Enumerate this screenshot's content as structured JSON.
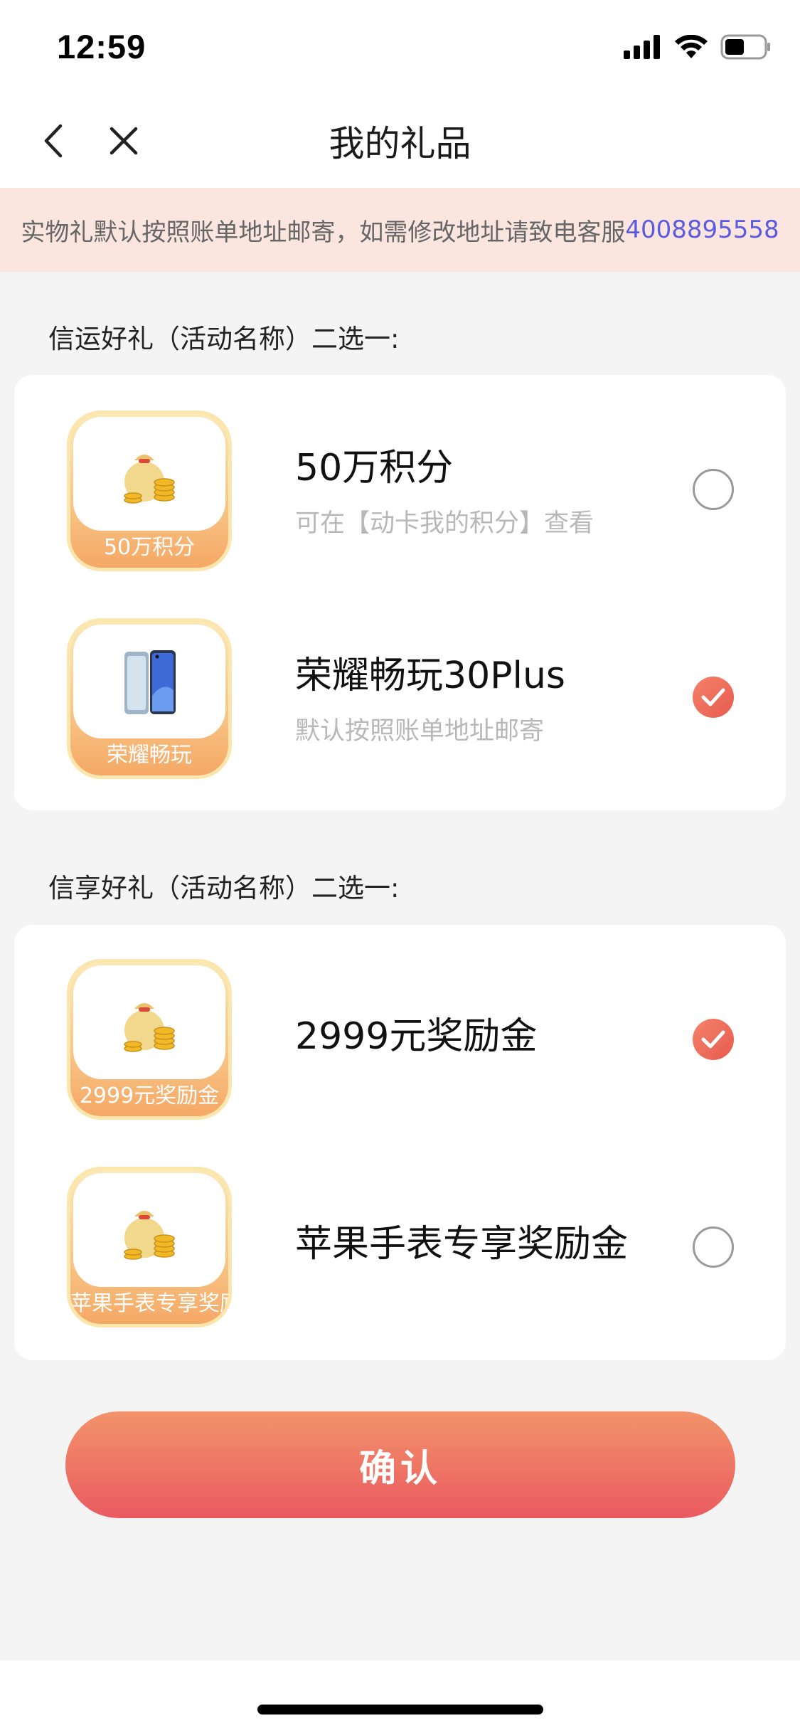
{
  "status_bar": {
    "time": "12:59"
  },
  "nav": {
    "title": "我的礼品"
  },
  "notice": {
    "text": "实物礼默认按照账单地址邮寄，如需修改地址请致电客服",
    "phone": "4008895558"
  },
  "sections": [
    {
      "title": "信运好礼（活动名称）二选一:",
      "items": [
        {
          "thumb_label": "50万积分",
          "title": "50万积分",
          "subtitle": "可在【动卡我的积分】查看",
          "checked": false,
          "icon": "money-bag-icon"
        },
        {
          "thumb_label": "荣耀畅玩",
          "title": "荣耀畅玩30Plus",
          "subtitle": "默认按照账单地址邮寄",
          "checked": true,
          "icon": "phone-icon"
        }
      ]
    },
    {
      "title": "信享好礼（活动名称）二选一:",
      "items": [
        {
          "thumb_label": "2999元奖励金",
          "title": "2999元奖励金",
          "subtitle": "",
          "checked": true,
          "icon": "money-bag-icon"
        },
        {
          "thumb_label": "苹果手表专享奖励金",
          "title": "苹果手表专享奖励金",
          "subtitle": "",
          "checked": false,
          "icon": "money-bag-icon"
        }
      ]
    }
  ],
  "confirm_label": "确认",
  "colors": {
    "accent": "#ea5a60",
    "accent_light": "#f2936a",
    "notice_bg": "#fbe5df",
    "link": "#5b5be0"
  }
}
